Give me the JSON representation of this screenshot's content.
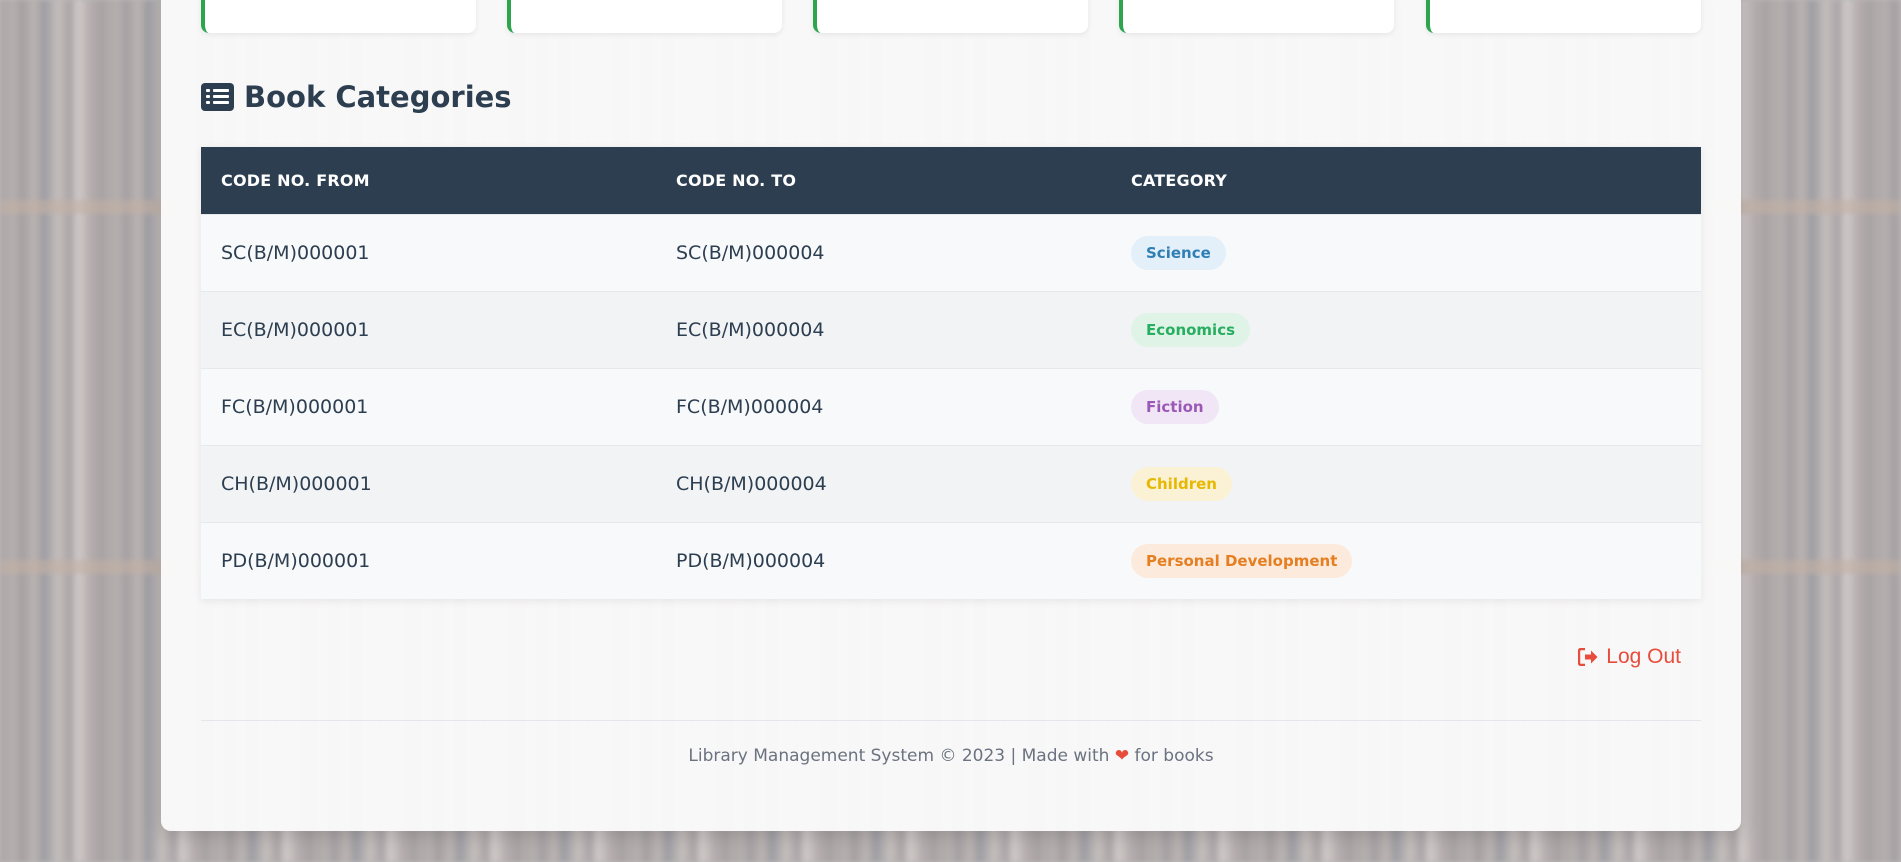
{
  "section": {
    "title": "Book Categories",
    "icon": "list-icon"
  },
  "table": {
    "headers": [
      "CODE NO. FROM",
      "CODE NO. TO",
      "CATEGORY"
    ],
    "rows": [
      {
        "from": "SC(B/M)000001",
        "to": "SC(B/M)000004",
        "category": "Science",
        "badge_bg": "#e3f0fa",
        "badge_fg": "#2f7fb5"
      },
      {
        "from": "EC(B/M)000001",
        "to": "EC(B/M)000004",
        "category": "Economics",
        "badge_bg": "#dff3e7",
        "badge_fg": "#27ae60"
      },
      {
        "from": "FC(B/M)000001",
        "to": "FC(B/M)000004",
        "category": "Fiction",
        "badge_bg": "#f1e6f6",
        "badge_fg": "#9b59b6"
      },
      {
        "from": "CH(B/M)000001",
        "to": "CH(B/M)000004",
        "category": "Children",
        "badge_bg": "#fbf2d6",
        "badge_fg": "#e6b800"
      },
      {
        "from": "PD(B/M)000001",
        "to": "PD(B/M)000004",
        "category": "Personal Development",
        "badge_bg": "#fcebdc",
        "badge_fg": "#e67e22"
      }
    ]
  },
  "logout": {
    "label": "Log Out",
    "icon": "sign-out-icon",
    "color": "#e74c3c"
  },
  "footer": {
    "text_before": "Library Management System © 2023 | Made with",
    "heart": "❤",
    "text_after": "for books"
  },
  "colors": {
    "header_bg": "#2c3e50",
    "accent_green": "#2ea44f"
  }
}
